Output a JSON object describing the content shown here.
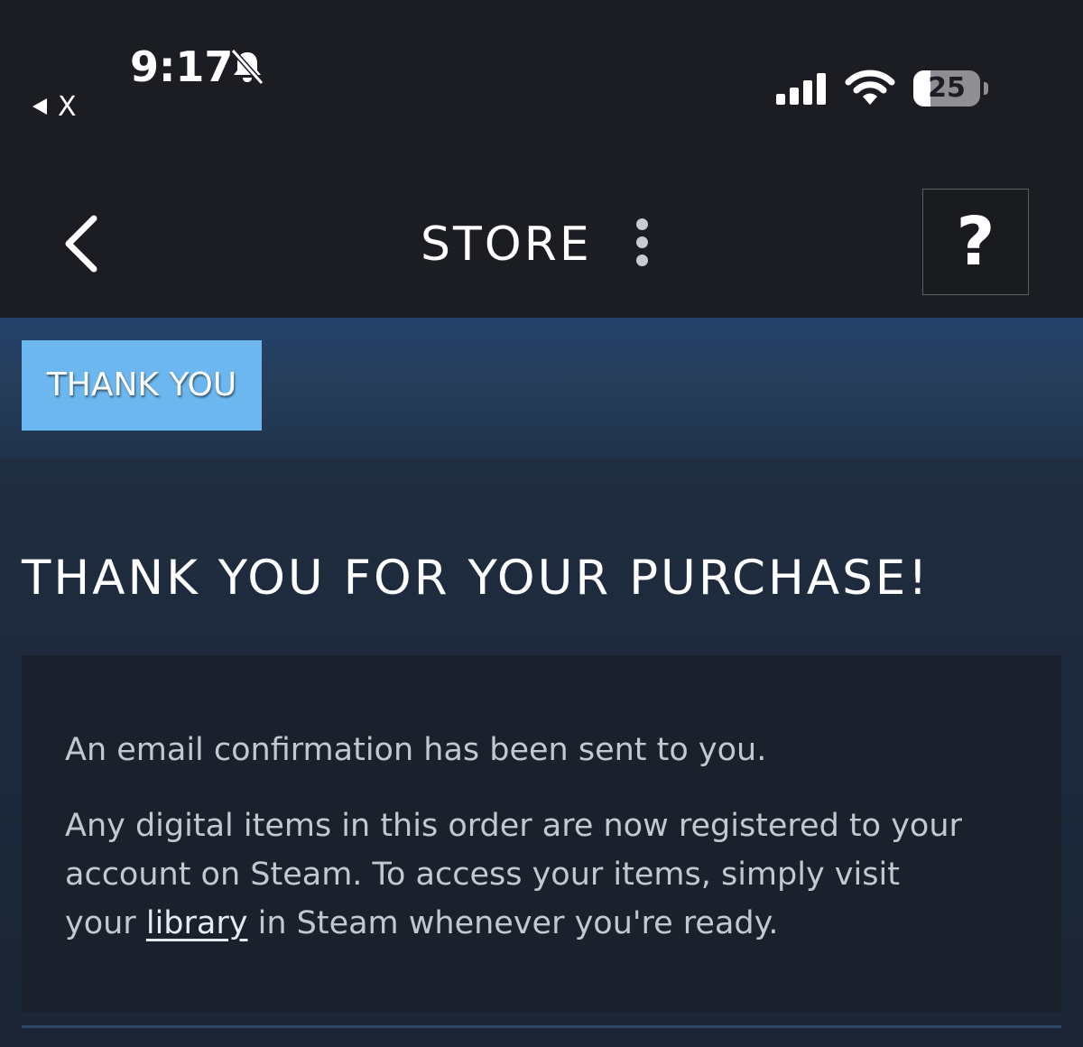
{
  "status_bar": {
    "time": "9:17",
    "back_to_app_label": "X",
    "battery_level": "25",
    "battery_fraction": 0.25,
    "icons": [
      "bell-slash-icon",
      "cellular-signal-icon",
      "wifi-icon",
      "battery-icon"
    ]
  },
  "header": {
    "title": "STORE",
    "help_label": "?",
    "icons": [
      "chevron-left-icon",
      "kebab-menu-icon"
    ]
  },
  "breadcrumb": {
    "active_tab": "THANK YOU"
  },
  "main": {
    "heading": "THANK YOU FOR YOUR PURCHASE!",
    "email_notice": "An email confirmation has been sent to you.",
    "registration_text_before": "Any digital items in this order are now registered to your account on Steam. To access your items, simply visit your",
    "library_link": "library",
    "registration_text_after": "in Steam whenever you're ready."
  },
  "colors": {
    "header_bg": "#1b1d22",
    "band_bg": "#263e5b",
    "tab_accent": "#6cb7ef",
    "page_bg": "#1b2535",
    "card_bg": "#1a212d",
    "body_text": "#c2c8d1"
  }
}
